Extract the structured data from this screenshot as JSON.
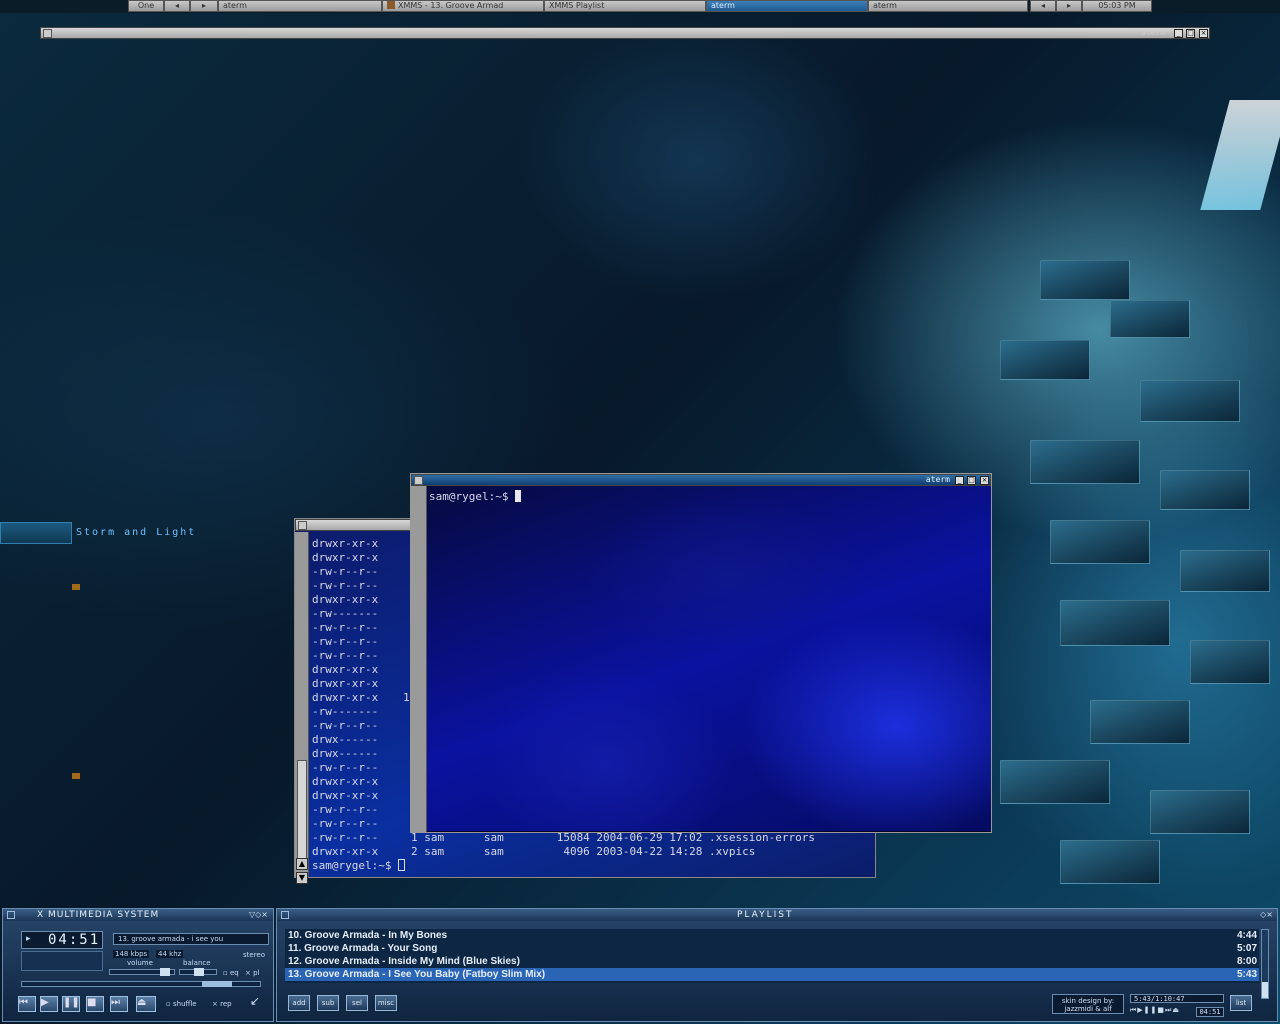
{
  "taskbar": {
    "workspace": "One",
    "tasks": [
      "aterm",
      "XMMS - 13. Groove Armad",
      "XMMS Playlist",
      "aterm",
      "aterm"
    ],
    "clock": "05:03 PM"
  },
  "desktop": {
    "wallpaper_text": "Storm and Light"
  },
  "top_window": {
    "title": "aterm"
  },
  "bg_terminal": {
    "perms": [
      "drwxr-xr-x",
      "drwxr-xr-x",
      "-rw-r--r--",
      "-rw-r--r--",
      "drwxr-xr-x",
      "-rw-------",
      "-rw-r--r--",
      "-rw-r--r--",
      "-rw-r--r--",
      "drwxr-xr-x",
      "drwxr-xr-x",
      "drwxr-xr-x",
      "-rw-------",
      "-rw-r--r--",
      "drwx------",
      "drwx------",
      "-rw-r--r--",
      "drwxr-xr-x",
      "drwxr-xr-x",
      "-rw-r--r--",
      "-rw-r--r--",
      "-rw-r--r--",
      "drwxr-xr-x"
    ],
    "stray": "1",
    "listing": [
      "1 sam      sam        15084 2004-06-29 17:02 .xsession-errors",
      "2 sam      sam         4096 2003-04-22 14:28 .xvpics"
    ],
    "prompt": "sam@rygel:~$ "
  },
  "fg_terminal": {
    "title": "aterm",
    "prompt": "sam@rygel:~$ "
  },
  "xmms": {
    "title": "X MULTIMEDIA SYSTEM",
    "time": "04:51",
    "song": "13. groove armada - i see you",
    "kbps": "148",
    "kbps_label": "kbps",
    "khz": "44",
    "khz_label": "khz",
    "stereo": "stereo",
    "volume_label": "volume",
    "balance_label": "balance",
    "eq": "eq",
    "pl": "pl",
    "shuffle": "shuffle",
    "repeat": "rep"
  },
  "playlist": {
    "title": "PLAYLIST",
    "rows": [
      {
        "label": "10. Groove Armada - In My Bones",
        "time": "4:44"
      },
      {
        "label": "11. Groove Armada - Your Song",
        "time": "5:07"
      },
      {
        "label": "12. Groove Armada - Inside My Mind (Blue Skies)",
        "time": "8:00"
      },
      {
        "label": "13. Groove Armada - I See You Baby (Fatboy Slim Mix)",
        "time": "5:43"
      }
    ],
    "buttons": [
      "add",
      "sub",
      "sel",
      "misc"
    ],
    "credit": "skin design by: jazzmidi & alf",
    "total": "5:43/1:10:47",
    "mini_time": "04:51",
    "list_button": "list"
  },
  "colors": {
    "selected_row": "#2a64b4",
    "term_bg": "#0a0a6e"
  }
}
